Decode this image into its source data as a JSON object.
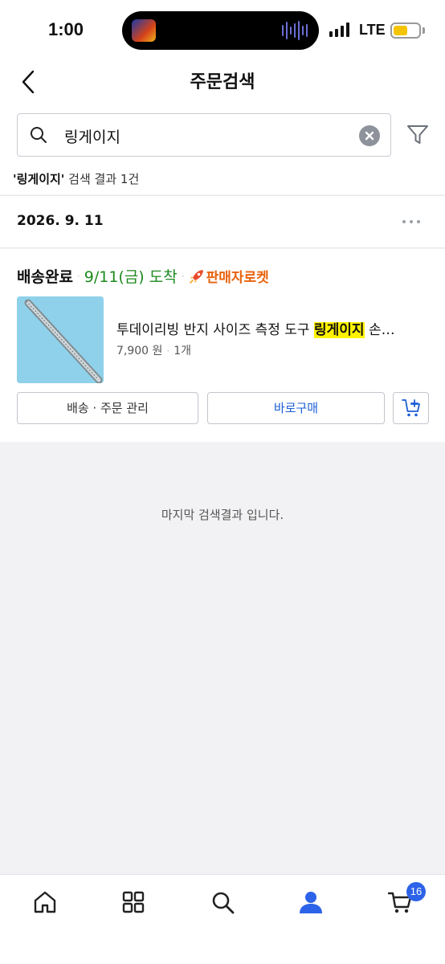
{
  "status_bar": {
    "time": "1:00",
    "network": "LTE",
    "battery_level": 0.55
  },
  "header": {
    "title": "주문검색"
  },
  "search": {
    "value": "링게이지"
  },
  "results": {
    "query_label": "'링게이지'",
    "summary_text": " 검색 결과 1건"
  },
  "order": {
    "date": "2026. 9. 11",
    "status": "배송완료",
    "arrival": "9/11(금) 도착",
    "seller_badge": "판매자로켓",
    "product": {
      "name_prefix": "투데이리빙 반지 사이즈 측정 도구 ",
      "name_highlight": "링게이지",
      "name_suffix": " 손…",
      "price": "7,900 원",
      "quantity": "1개"
    },
    "buttons": {
      "manage": "배송 · 주문 관리",
      "rebuy": "바로구매"
    }
  },
  "end_message": "마지막 검색결과 입니다.",
  "nav": {
    "cart_count": "16"
  },
  "colors": {
    "accent": "#1d5fd6",
    "arrival_green": "#1e8a1e",
    "rocket_orange": "#e8620c",
    "highlight": "#fff200"
  },
  "icons": [
    "back-icon",
    "search-icon",
    "clear-icon",
    "filter-icon",
    "more-icon",
    "rocket-icon",
    "cart-add-icon",
    "home-icon",
    "category-icon",
    "search-nav-icon",
    "my-page-icon",
    "cart-icon"
  ]
}
